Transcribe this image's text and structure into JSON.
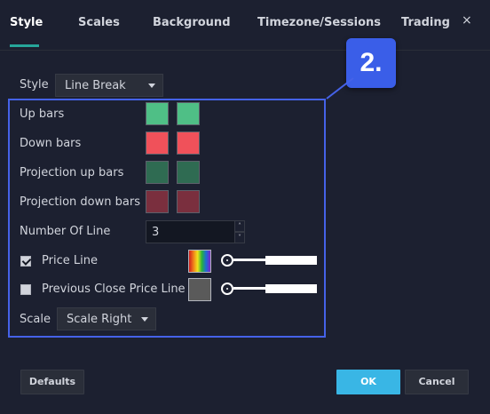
{
  "tabs": [
    {
      "label": "Style",
      "active": true
    },
    {
      "label": "Scales",
      "active": false
    },
    {
      "label": "Background",
      "active": false
    },
    {
      "label": "Timezone/Sessions",
      "active": false
    },
    {
      "label": "Trading",
      "active": false
    }
  ],
  "close_glyph": "×",
  "style_row": {
    "label": "Style",
    "selected": "Line Break"
  },
  "annotation_badge": "2.",
  "colors": {
    "accent_tab": "#26a69a",
    "highlight": "#4562e8",
    "ok_button": "#39b6e5",
    "up_bars": "#4fbf86",
    "down_bars": "#f0515a",
    "projection_up_bars": "#2f6b52",
    "projection_down_bars": "#7a2f3e",
    "previous_close": "#5a5a5a"
  },
  "rows": {
    "up_bars": "Up bars",
    "down_bars": "Down bars",
    "projection_up_bars": "Projection up bars",
    "projection_down_bars": "Projection down bars",
    "number_of_line": "Number Of Line",
    "number_of_line_value": "3",
    "price_line": "Price Line",
    "price_line_checked": true,
    "previous_close": "Previous Close Price Line",
    "previous_close_checked": false
  },
  "scale_row": {
    "label": "Scale",
    "selected": "Scale Right"
  },
  "footer": {
    "defaults": "Defaults",
    "ok": "OK",
    "cancel": "Cancel"
  }
}
